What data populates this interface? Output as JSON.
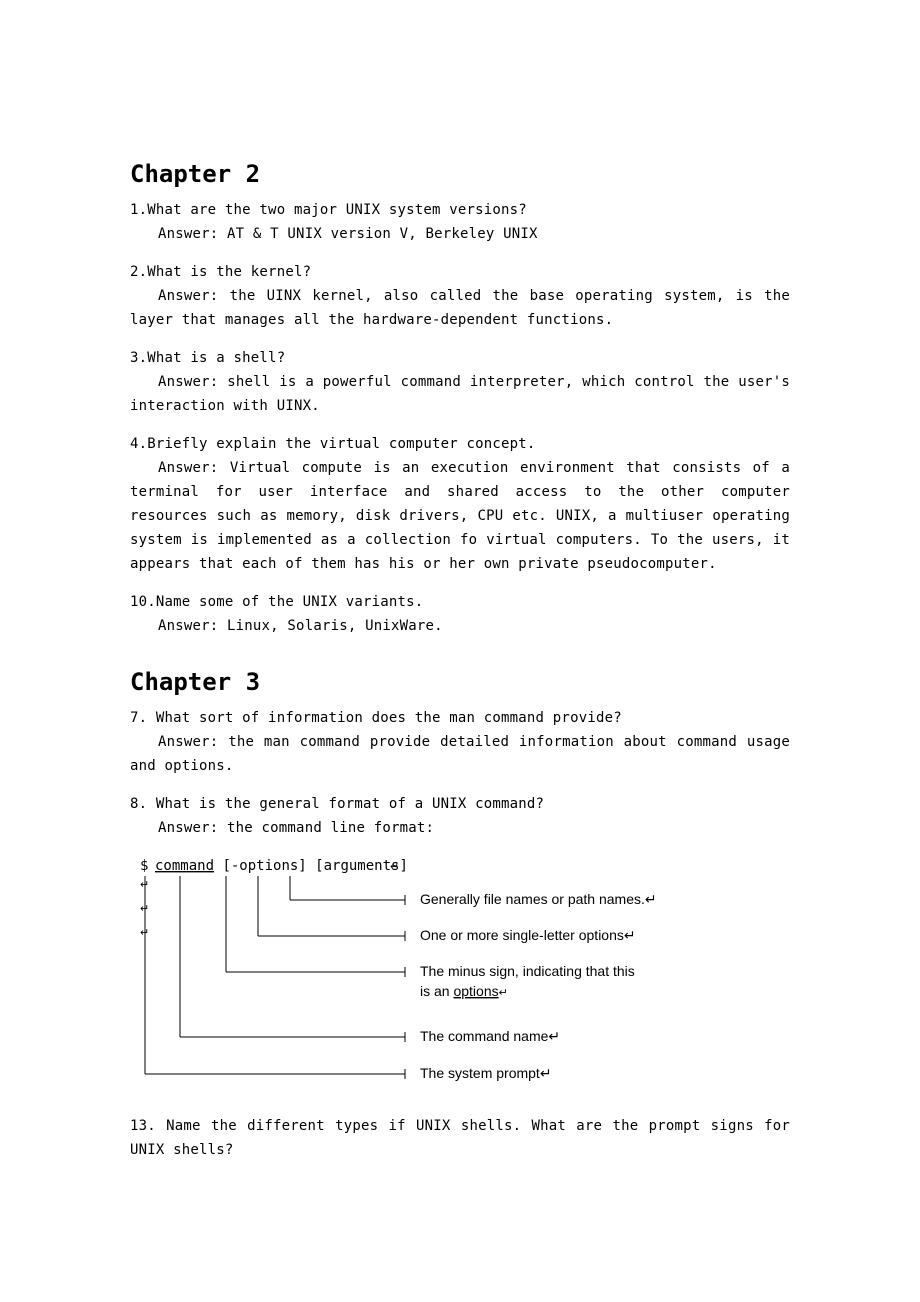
{
  "chapter2": {
    "title": "Chapter 2",
    "q1": {
      "question": "1.What are the two major UNIX system versions?",
      "answer": "Answer: AT & T UNIX version V, Berkeley UNIX"
    },
    "q2": {
      "question": "2.What is the kernel?",
      "answer": "Answer: the UINX kernel, also called the base operating system, is the layer that manages all the hardware-dependent functions."
    },
    "q3": {
      "question": "3.What is a shell?",
      "answer": "Answer: shell is a powerful command interpreter, which control the user's interaction with UINX."
    },
    "q4": {
      "question": "4.Briefly explain the virtual computer concept.",
      "answer": "Answer: Virtual compute is an execution environment that consists of a terminal for user interface and shared access to the other computer resources such as memory, disk drivers, CPU etc. UNIX, a multiuser operating system is implemented as a collection fo virtual computers. To the users, it appears that each of them has his or her own private pseudocomputer."
    },
    "q10": {
      "question": "10.Name some of the UNIX variants.",
      "answer": "Answer: Linux, Solaris, UnixWare."
    }
  },
  "chapter3": {
    "title": "Chapter 3",
    "q7": {
      "question": "7. What sort of information does the man command provide?",
      "answer": "Answer: the man command provide detailed information about command usage and options."
    },
    "q8": {
      "question": "8. What is the general format of a UNIX command?",
      "answer": "Answer: the command line format:"
    },
    "q13": {
      "question": "13. Name the different types if UNIX shells. What are the prompt signs for UNIX shells?"
    }
  },
  "diagram": {
    "dollar": "$",
    "command": "command",
    "options": " [-options] [arguments]",
    "break_mark": "↵",
    "label_arguments": "Generally file names or path names.↵",
    "label_options_desc": "One or more single-letter options↵",
    "label_minus1": "The minus sign, indicating that this",
    "label_minus2_pre": "is an ",
    "label_minus2_opt": "options",
    "label_minus2_post": "↵",
    "label_cmdname": "The command name↵",
    "label_prompt": "The system prompt↵"
  }
}
